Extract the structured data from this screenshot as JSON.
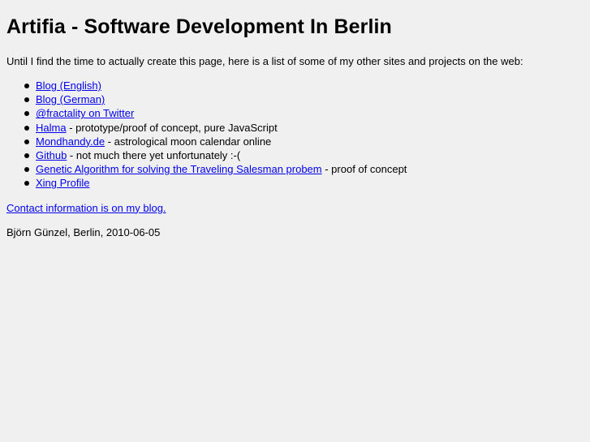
{
  "page": {
    "title": "Artifia - Software Development In Berlin",
    "intro": "Until I find the time to actually create this page, here is a list of some of my other sites and projects on the web:",
    "contact_link": "Contact information is on my blog.",
    "signature": "Björn Günzel, Berlin, 2010-06-05"
  },
  "links": [
    {
      "label": "Blog (English)",
      "suffix": ""
    },
    {
      "label": "Blog (German)",
      "suffix": ""
    },
    {
      "label": "@fractality on Twitter",
      "suffix": ""
    },
    {
      "label": "Halma",
      "suffix": " - prototype/proof of concept, pure JavaScript"
    },
    {
      "label": "Mondhandy.de",
      "suffix": " - astrological moon calendar online"
    },
    {
      "label": "Github",
      "suffix": " - not much there yet unfortunately :-("
    },
    {
      "label": "Genetic Algorithm for solving the Traveling Salesman probem",
      "suffix": " - proof of concept"
    },
    {
      "label": "Xing Profile",
      "suffix": ""
    }
  ],
  "colors": {
    "background": "#f0f0f0",
    "text": "#000000",
    "link": "#0000ee"
  }
}
